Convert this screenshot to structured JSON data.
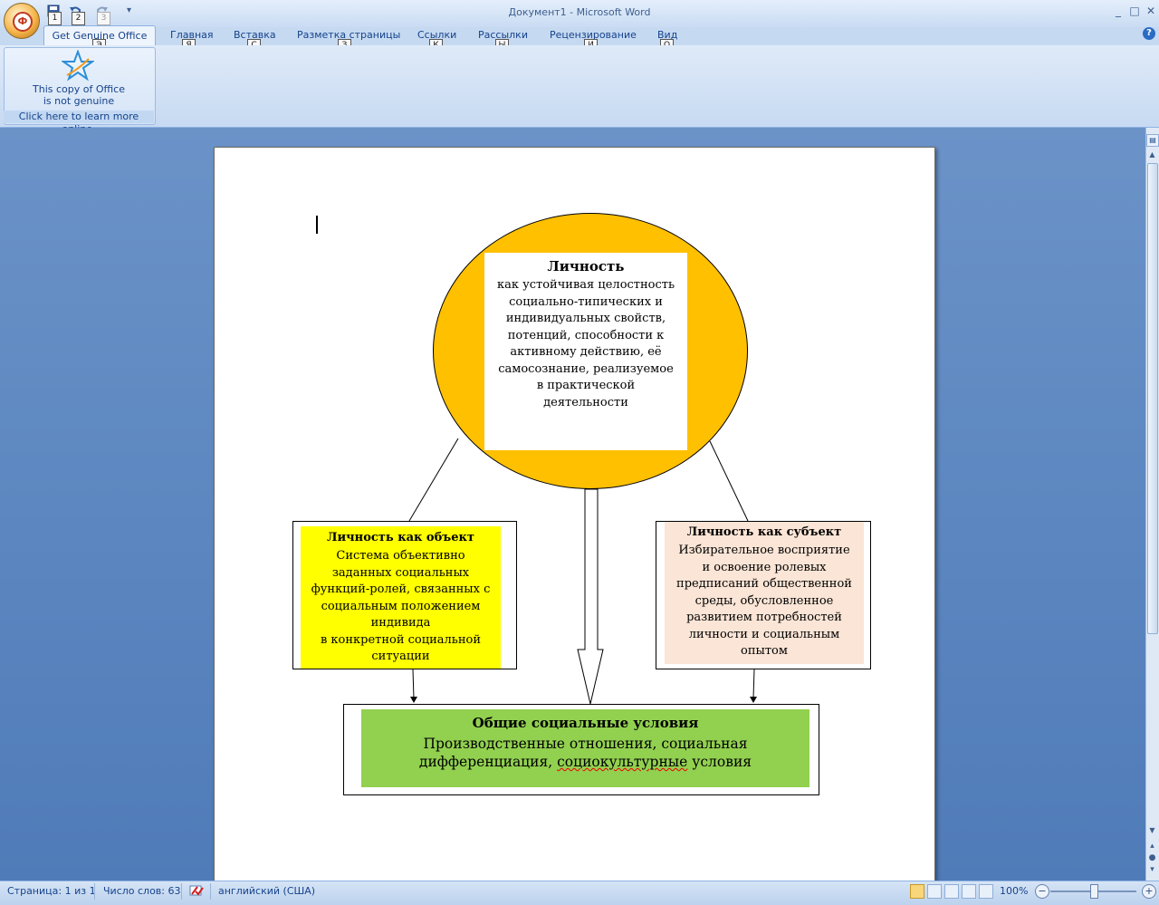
{
  "window": {
    "title": "Документ1 - Microsoft Word",
    "office_button_glyph": "Ф",
    "controls": [
      "_",
      "□",
      "✕"
    ]
  },
  "quick_access": {
    "keytips": [
      "1",
      "2",
      "3"
    ],
    "customize_glyph": "▾",
    "icons": [
      "save-icon",
      "undo-icon",
      "redo-icon"
    ]
  },
  "tabs": {
    "active": "Get Genuine Office",
    "items": [
      {
        "label": "Get Genuine Office",
        "keytip": "Э"
      },
      {
        "label": "Главная",
        "keytip": "Я"
      },
      {
        "label": "Вставка",
        "keytip": "С"
      },
      {
        "label": "Разметка страницы",
        "keytip": "З"
      },
      {
        "label": "Ссылки",
        "keytip": "К"
      },
      {
        "label": "Рассылки",
        "keytip": "Ы"
      },
      {
        "label": "Рецензирование",
        "keytip": "И"
      },
      {
        "label": "Вид",
        "keytip": "О"
      }
    ],
    "help_glyph": "?"
  },
  "ribbon": {
    "genuine_line1": "This copy of Office",
    "genuine_line2": "is not genuine",
    "learn_more": "Click here to learn more online."
  },
  "diagram": {
    "center": {
      "title": "Личность",
      "body": [
        "как устойчивая целостность",
        "социально-типических и",
        "индивидуальных свойств,",
        "потенций, способности к",
        "активному действию, её",
        "самосознание, реализуемое",
        "в практической",
        "деятельности"
      ]
    },
    "object": {
      "title": "Личность как объект",
      "body": [
        "Система объективно",
        "заданных социальных",
        "функций-ролей, связанных с",
        "социальным положением",
        "индивида",
        "в конкретной социальной",
        "ситуации"
      ]
    },
    "subject": {
      "title": "Личность как субъект",
      "body": [
        "Избирательное восприятие",
        "и освоение ролевых",
        "предписаний общественной",
        "среды, обусловленное",
        "развитием потребностей",
        "личности и социальным",
        "опытом"
      ]
    },
    "general": {
      "title": "Общие социальные условия",
      "line1": "Производственные отношения, социальная",
      "line2_a": "дифференциация, ",
      "line2_b": "социокультурные",
      "line2_c": " условия"
    }
  },
  "status": {
    "page": "Страница: 1 из 1",
    "words": "Число слов: 63",
    "language": "английский (США)",
    "zoom": "100%",
    "zoom_out": "−",
    "zoom_in": "+",
    "zoom_level_percent": 100,
    "accent": "#15428b"
  }
}
